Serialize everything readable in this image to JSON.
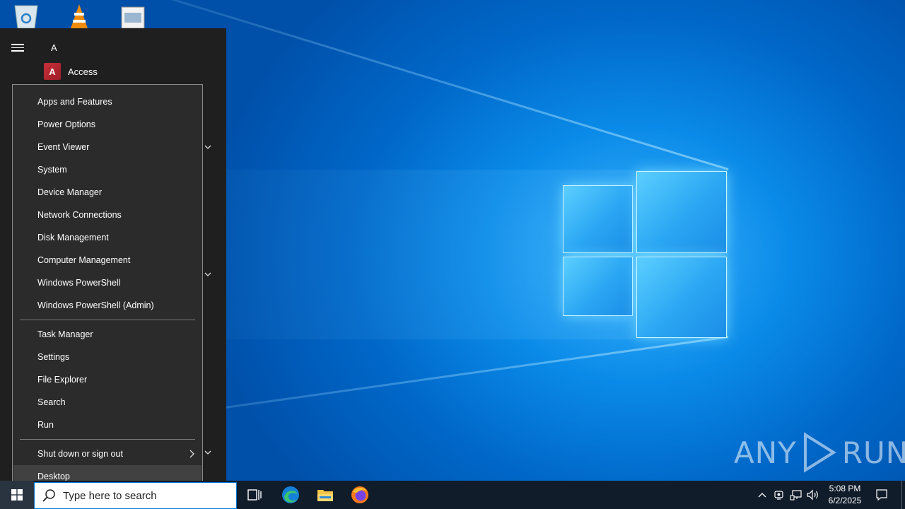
{
  "start_menu": {
    "section_letter": "A",
    "first_app": "Access",
    "access_tile_letter": "A"
  },
  "context_menu": {
    "items_group1": [
      "Apps and Features",
      "Power Options",
      "Event Viewer",
      "System",
      "Device Manager",
      "Network Connections",
      "Disk Management",
      "Computer Management",
      "Windows PowerShell",
      "Windows PowerShell (Admin)"
    ],
    "items_group2": [
      "Task Manager",
      "Settings",
      "File Explorer",
      "Search",
      "Run"
    ],
    "shutdown": "Shut down or sign out",
    "desktop": "Desktop"
  },
  "taskbar": {
    "search_placeholder": "Type here to search",
    "pinned_icons": [
      "task-view-icon",
      "edge-icon",
      "file-explorer-icon",
      "firefox-icon"
    ],
    "tray_icons": [
      "chevron-up-icon",
      "meet-now-icon",
      "network-icon",
      "volume-icon"
    ],
    "clock_time": "5:08 PM",
    "clock_date": "6/2/2025"
  },
  "watermark": {
    "left": "ANY",
    "right": "RUN"
  },
  "colors": {
    "menu_bg": "#2b2b2b",
    "start_bg": "#1f1f1f",
    "taskbar_bg": "#101c2a",
    "accent": "#0078d7"
  }
}
